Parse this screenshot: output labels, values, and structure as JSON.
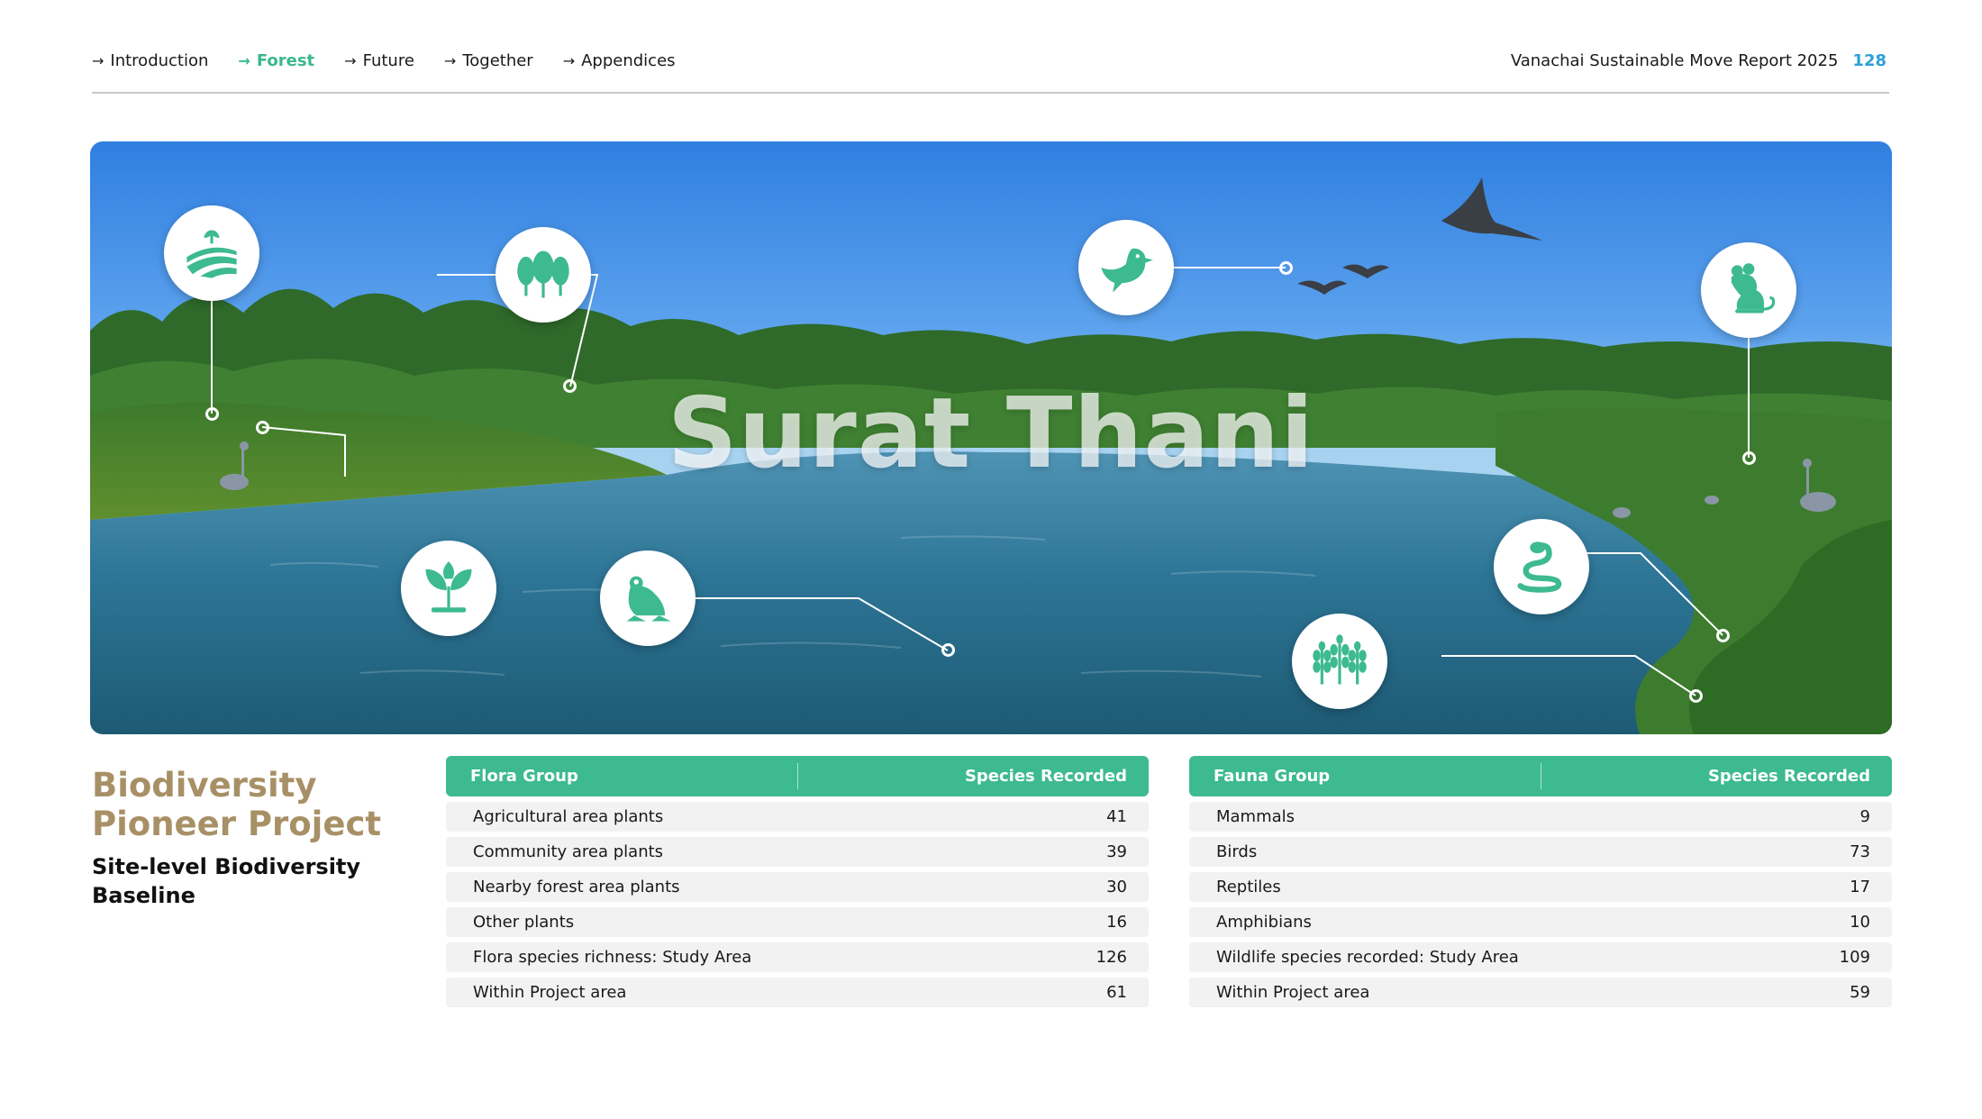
{
  "nav": {
    "items": [
      {
        "label": "Introduction",
        "active": false
      },
      {
        "label": "Forest",
        "active": true
      },
      {
        "label": "Future",
        "active": false
      },
      {
        "label": "Together",
        "active": false
      },
      {
        "label": "Appendices",
        "active": false
      }
    ],
    "report_title": "Vanachai Sustainable Move Report 2025",
    "page_number": "128"
  },
  "hero": {
    "title": "Surat Thani",
    "icons": [
      "farmland-sprout-icon",
      "trees-icon",
      "bird-icon",
      "rodent-icon",
      "seedling-icon",
      "frog-icon",
      "snake-icon",
      "plants-icon"
    ]
  },
  "project": {
    "title": "Biodiversity Pioneer Project",
    "subtitle": "Site-level Biodiversity Baseline"
  },
  "flora": {
    "header_group": "Flora Group",
    "header_count": "Species Recorded",
    "rows": [
      {
        "label": "Agricultural area plants",
        "value": "41"
      },
      {
        "label": "Community area plants",
        "value": "39"
      },
      {
        "label": "Nearby forest area plants",
        "value": "30"
      },
      {
        "label": "Other plants",
        "value": "16"
      },
      {
        "label": "Flora species richness: Study Area",
        "value": "126"
      },
      {
        "label": "Within Project area",
        "value": "61"
      }
    ]
  },
  "fauna": {
    "header_group": "Fauna Group",
    "header_count": "Species Recorded",
    "rows": [
      {
        "label": "Mammals",
        "value": "9"
      },
      {
        "label": "Birds",
        "value": "73"
      },
      {
        "label": "Reptiles",
        "value": "17"
      },
      {
        "label": "Amphibians",
        "value": "10"
      },
      {
        "label": "Wildlife species recorded: Study Area",
        "value": "109"
      },
      {
        "label": "Within Project area",
        "value": "59"
      }
    ]
  },
  "colors": {
    "accent_green": "#3dba8f",
    "title_gold": "#a89066",
    "page_blue": "#2f9fd8"
  }
}
